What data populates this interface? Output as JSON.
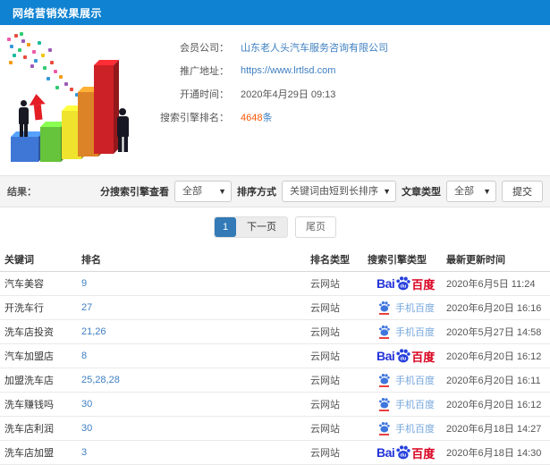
{
  "header": {
    "title": "网络营销效果展示"
  },
  "info": {
    "company": {
      "label": "会员公司：",
      "value": "山东老人头汽车服务咨询有限公司"
    },
    "url": {
      "label": "推广地址：",
      "value": "https://www.lrtlsd.com"
    },
    "open_time": {
      "label": "开通时间：",
      "value": "2020年4月29日 09:13"
    },
    "engine_rank": {
      "label": "搜索引擎排名：",
      "count": "4648",
      "unit": "条"
    }
  },
  "filters": {
    "result_label": "结果：",
    "engine_filter": {
      "label": "分搜索引擎查看",
      "value": "全部"
    },
    "sort_filter": {
      "label": "排序方式",
      "value": "关键词由短到长排序"
    },
    "article_filter": {
      "label": "文章类型",
      "value": "全部"
    },
    "caret": "▼",
    "submit_label": "提交"
  },
  "pagination": {
    "current": "1",
    "next": "下一页",
    "last": "尾页"
  },
  "table": {
    "headers": [
      "关键词",
      "排名",
      "排名类型",
      "搜索引擎类型",
      "最新更新时间"
    ],
    "rows": [
      {
        "keyword": "汽车美容",
        "rank": "9",
        "rank_type": "云网站",
        "engine": "baidu",
        "updated": "2020年6月5日 11:24"
      },
      {
        "keyword": "开洗车行",
        "rank": "27",
        "rank_type": "云网站",
        "engine": "baidu-mobile",
        "updated": "2020年6月20日 16:16"
      },
      {
        "keyword": "洗车店投资",
        "rank": "21,26",
        "rank_type": "云网站",
        "engine": "baidu-mobile",
        "updated": "2020年5月27日 14:58"
      },
      {
        "keyword": "汽车加盟店",
        "rank": "8",
        "rank_type": "云网站",
        "engine": "baidu",
        "updated": "2020年6月20日 16:12"
      },
      {
        "keyword": "加盟洗车店",
        "rank": "25,28,28",
        "rank_type": "云网站",
        "engine": "baidu-mobile",
        "updated": "2020年6月20日 16:11"
      },
      {
        "keyword": "洗车赚钱吗",
        "rank": "30",
        "rank_type": "云网站",
        "engine": "baidu-mobile",
        "updated": "2020年6月20日 16:12"
      },
      {
        "keyword": "洗车店利润",
        "rank": "30",
        "rank_type": "云网站",
        "engine": "baidu-mobile",
        "updated": "2020年6月18日 14:27"
      },
      {
        "keyword": "洗车店加盟",
        "rank": "3",
        "rank_type": "云网站",
        "engine": "baidu",
        "updated": "2020年6月18日 14:30"
      }
    ]
  },
  "logos": {
    "baidu": {
      "prefix": "Bai",
      "du": "du",
      "suffix": "百度"
    },
    "baidu_mobile": {
      "label": "手机百度"
    }
  },
  "colors": {
    "header_bg": "#0f82d2",
    "link": "#3e7fc1",
    "rank_count": "#ff5704",
    "active_page": "#337ab7",
    "baidu_blue": "#2433d9",
    "baidu_red": "#d9001f",
    "filter_bg": "#f4f4f4"
  }
}
